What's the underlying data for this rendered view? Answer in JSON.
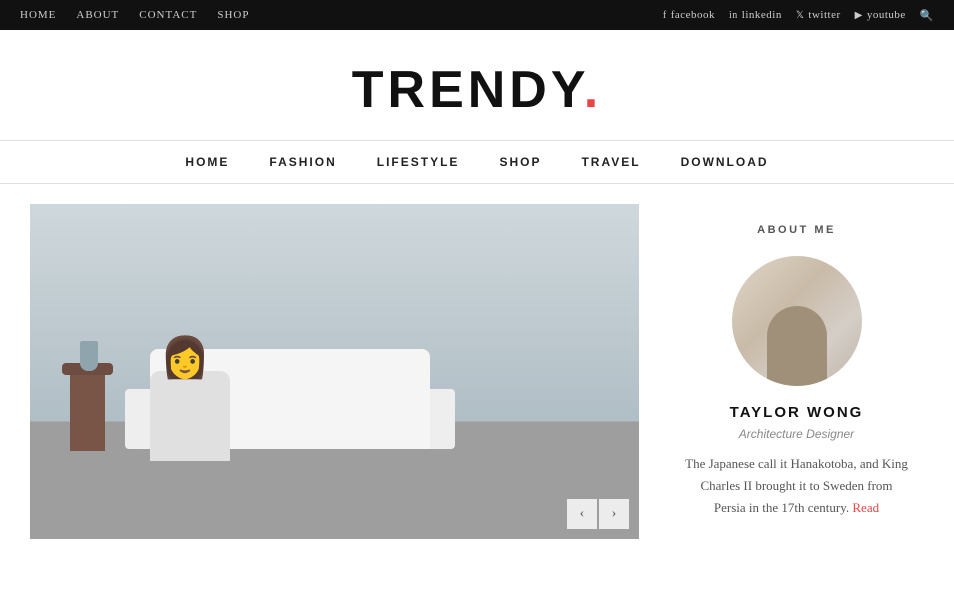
{
  "topBar": {
    "nav": [
      {
        "label": "HOME",
        "id": "top-home"
      },
      {
        "label": "ABOUT",
        "id": "top-about"
      },
      {
        "label": "CONTACT",
        "id": "top-contact"
      },
      {
        "label": "SHOP",
        "id": "top-shop"
      }
    ],
    "social": [
      {
        "icon": "facebook-icon",
        "label": "facebook"
      },
      {
        "icon": "linkedin-icon",
        "label": "linkedin"
      },
      {
        "icon": "twitter-icon",
        "label": "twitter"
      },
      {
        "icon": "youtube-icon",
        "label": "youtube"
      }
    ],
    "searchIcon": "🔍"
  },
  "header": {
    "logoText": "TRENDY",
    "logoDot": "."
  },
  "mainNav": {
    "items": [
      {
        "label": "HOME"
      },
      {
        "label": "FASHION"
      },
      {
        "label": "LIFESTYLE"
      },
      {
        "label": "SHOP"
      },
      {
        "label": "TRAVEL"
      },
      {
        "label": "DOWNLOAD"
      }
    ]
  },
  "slider": {
    "prevIcon": "‹",
    "nextIcon": "›"
  },
  "sidebar": {
    "aboutTitle": "ABOUT ME",
    "personName": "TAYLOR WONG",
    "personTitle": "Architecture Designer",
    "personBio": "The Japanese call it Hanakotoba, and King Charles II brought it to Sweden from Persia in the 17th century.",
    "readMore": "Read"
  }
}
